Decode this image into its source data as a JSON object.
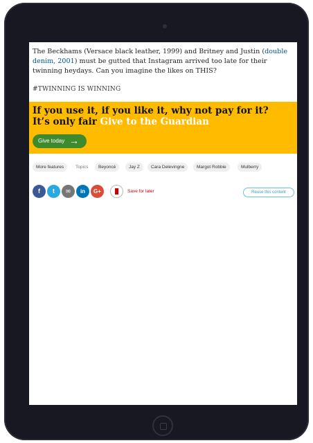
{
  "article": {
    "para_prefix": "The Beckhams (Versace black leather, 1999) and Britney and Justin (",
    "para_link": "double denim, 2001",
    "para_suffix": ") must be gutted that Instagram arrived too late for their twinning heydays. Can you imagine the likes on THIS?",
    "hashtag": "#TWINNING IS WINNING"
  },
  "banner": {
    "text": "If you use it, if you like it, why not pay for it? It’s only fair",
    "cta": "Give to the Guardian",
    "button_label": "Give today",
    "button_arrow": "→"
  },
  "topics": {
    "more_features": "More features",
    "label": "Topics",
    "items": [
      "Beyoncé",
      "Jay Z",
      "Cara Delevingne",
      "Margot Robbie",
      "Mulberry"
    ]
  },
  "share": {
    "facebook": "f",
    "twitter": "t",
    "email": "✉",
    "linkedin": "in",
    "googleplus": "G+",
    "save_label": "Save for later",
    "reuse_label": "Reuse this content"
  },
  "colors": {
    "banner": "#ffbb00",
    "button": "#3f8a2d",
    "facebook": "#3b5998",
    "twitter": "#2aa9e0",
    "email": "#767676",
    "linkedin": "#0077b5",
    "googleplus": "#dc4a38"
  }
}
